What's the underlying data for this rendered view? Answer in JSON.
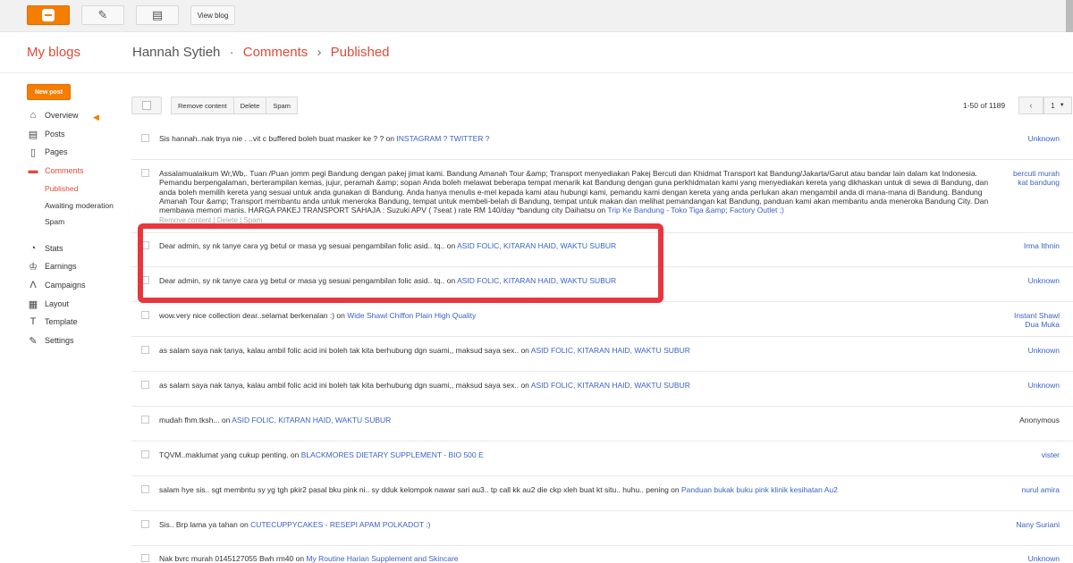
{
  "toolbar": {
    "view_blog_label": "View blog",
    "icons": [
      "blogger-logo-icon",
      "pencil-icon",
      "pages-icon"
    ]
  },
  "header": {
    "my_blogs": "My blogs",
    "blog_name": "Hannah Sytieh",
    "sep1": "·",
    "crumb_comments": "Comments",
    "sep2": "›",
    "crumb_published": "Published"
  },
  "sidebar": {
    "new_post": "New post",
    "items": [
      {
        "label": "Overview",
        "icon": "home-icon"
      },
      {
        "label": "Posts",
        "icon": "posts-icon"
      },
      {
        "label": "Pages",
        "icon": "pages-icon"
      },
      {
        "label": "Comments",
        "icon": "comments-icon"
      },
      {
        "label": "Stats",
        "icon": "stats-icon"
      },
      {
        "label": "Earnings",
        "icon": "trophy-icon"
      },
      {
        "label": "Campaigns",
        "icon": "campaigns-icon"
      },
      {
        "label": "Layout",
        "icon": "layout-icon"
      },
      {
        "label": "Template",
        "icon": "template-icon"
      },
      {
        "label": "Settings",
        "icon": "wrench-icon"
      }
    ],
    "sub": [
      "Published",
      "Awaiting moderation",
      "Spam"
    ]
  },
  "actions": {
    "remove_content": "Remove content",
    "delete": "Delete",
    "spam": "Spam",
    "range": "1-50 of 1189",
    "page": "1"
  },
  "comments": [
    {
      "text": "Sis hannah..nak tnya nie . ..vit c buffered boleh buat masker ke ? ? on ",
      "link": "INSTAGRAM ? TWITTER ?",
      "author": "Unknown"
    },
    {
      "text": "Assalamualaikum Wr,Wb,. Tuan /Puan jomm pegi Bandung dengan pakej jimat kami. Bandung Amanah Tour &amp; Transport menyediakan Pakej Bercuti dan Khidmat Transport kat Bandung/Jakarta/Garut atau bandar lain dalam kat Indonesia. Pemandu berpengalaman, berterampilan kemas, jujur, peramah &amp; sopan Anda boleh melawat beberapa tempat menarik kat Bandung dengan guna perkhidmatan kami yang menyediakan kereta yang dikhaskan untuk di sewa di Bandung, dan anda boleh memilih kereta yang sesuai untuk anda gunakan di Bandung. Anda hanya menulis e-mel kepada kami atau hubungi kami, pemandu kami dengan kereta yang anda perlukan akan mengambil anda di mana-mana di Bandung. Bandung Amanah Tour &amp; Transport membantu anda untuk meneroka Bandung, tempat untuk membeli-belah di Bandung, tempat untuk makan dan melihat pemandangan kat Bandung, panduan kami akan membantu anda meneroka Bandung City. Dan membawa memori manis. HARGA PAKEJ TRANSPORT SAHAJA : Suzuki APV ( 7seat ) rate RM 140/day *bandung city Daihatsu on ",
      "link": "Trip Ke Bandung - Toko Tiga &amp; Factory Outlet ;)",
      "author": "bercuti murah kat bandung",
      "links_text": "Remove content | Delete | Spam"
    },
    {
      "text": "Dear admin, sy nk tanye cara yg betul or masa yg sesuai pengambilan folic asid.. tq.. on ",
      "link": "ASID FOLIC, KITARAN HAID, WAKTU SUBUR",
      "author": "Irma Ithnin"
    },
    {
      "text": "Dear admin, sy nk tanye cara yg betul or masa yg sesuai pengambilan folic asid.. tq.. on ",
      "link": "ASID FOLIC, KITARAN HAID, WAKTU SUBUR",
      "author": "Unknown"
    },
    {
      "text": "wow.very nice collection dear..selamat berkenalan :) on ",
      "link": "Wide Shawl Chiffon Plain High Quality",
      "author": "Instant Shawl Dua Muka"
    },
    {
      "text": "as salam saya nak tanya, kalau ambil folic acid ini boleh tak kita berhubung dgn suami,, maksud saya sex.. on ",
      "link": "ASID FOLIC, KITARAN HAID, WAKTU SUBUR",
      "author": "Unknown"
    },
    {
      "text": "as salam saya nak tanya, kalau ambil folic acid ini boleh tak kita berhubung dgn suami,, maksud saya sex.. on ",
      "link": "ASID FOLIC, KITARAN HAID, WAKTU SUBUR",
      "author": "Unknown"
    },
    {
      "text": "mudah fhm.tksh... on ",
      "link": "ASID FOLIC, KITARAN HAID, WAKTU SUBUR",
      "author": "Anonymous",
      "plain": true
    },
    {
      "text": "TQVM..maklumat yang cukup penting. on ",
      "link": "BLACKMORES DIETARY SUPPLEMENT - BIO 500 E",
      "author": "vister"
    },
    {
      "text": "salam hye sis.. sgt membntu sy yg tgh pkir2 pasal bku pink ni.. sy dduk kelompok nawar sari au3.. tp call kk au2 die ckp xleh buat kt situ.. huhu.. pening on ",
      "link": "Panduan bukak buku pink klinik kesihatan Au2",
      "author": "nurul amira"
    },
    {
      "text": "Sis.. Brp lama ya tahan on ",
      "link": "CUTECUPPYCAKES - RESEPI APAM POLKADOT :)",
      "author": "Nany Suriani"
    },
    {
      "text": "Nak bvrc murah 0145127055 Bwh rm40 on ",
      "link": "My Routine Harian Supplement and Skincare",
      "author": "Unknown"
    }
  ]
}
